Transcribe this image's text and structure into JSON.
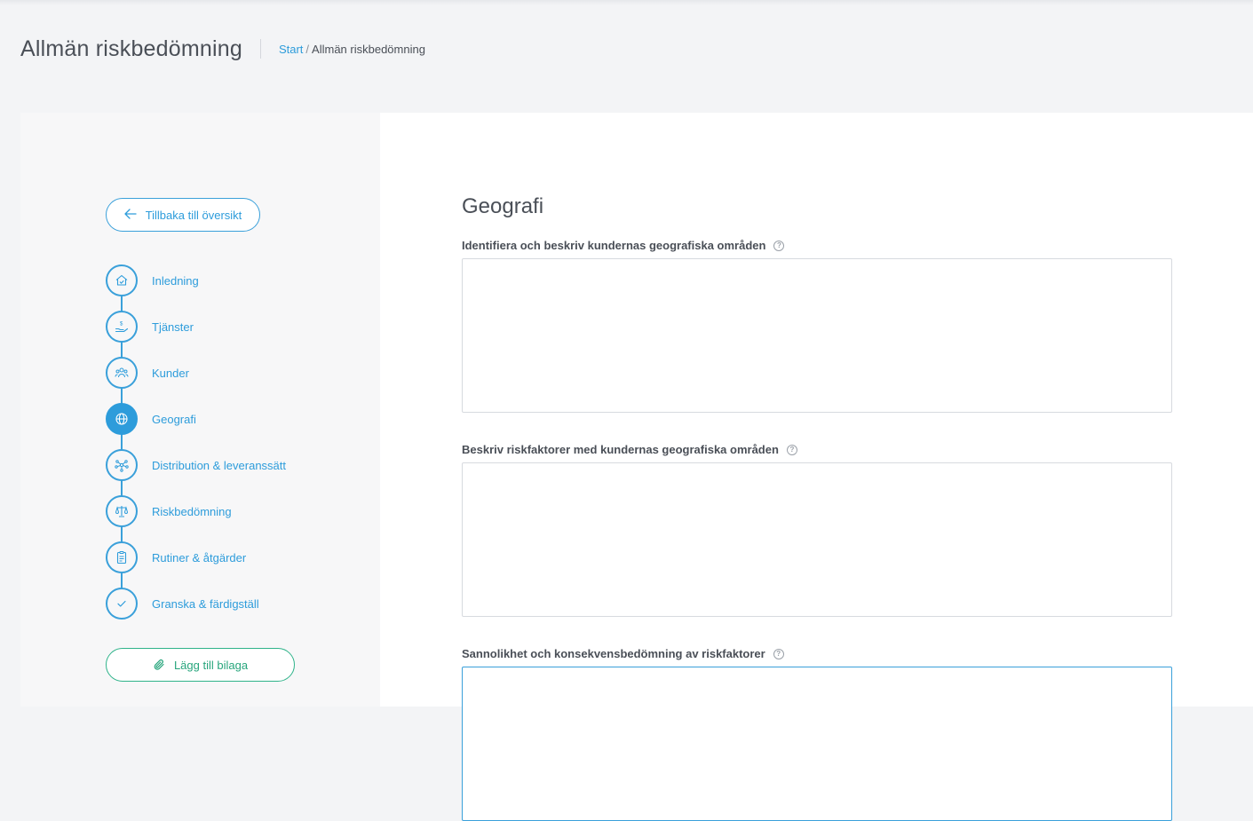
{
  "header": {
    "title": "Allmän riskbedömning",
    "breadcrumb": {
      "link": "Start",
      "separator": "/",
      "current": "Allmän riskbedömning"
    }
  },
  "sidebar": {
    "back_label": "Tillbaka till översikt",
    "attach_label": "Lägg till bilaga",
    "steps": [
      {
        "label": "Inledning",
        "icon": "house-check-icon"
      },
      {
        "label": "Tjänster",
        "icon": "hand-dollar-icon"
      },
      {
        "label": "Kunder",
        "icon": "people-icon"
      },
      {
        "label": "Geografi",
        "icon": "globe-icon",
        "active": true
      },
      {
        "label": "Distribution & leveranssätt",
        "icon": "network-icon"
      },
      {
        "label": "Riskbedömning",
        "icon": "scales-icon"
      },
      {
        "label": "Rutiner & åtgärder",
        "icon": "clipboard-icon"
      },
      {
        "label": "Granska & färdigställ",
        "icon": "checkmark-icon"
      }
    ]
  },
  "main": {
    "section_title": "Geografi",
    "fields": [
      {
        "label": "Identifiera och beskriv kundernas geografiska områden",
        "value": ""
      },
      {
        "label": "Beskriv riskfaktorer med kundernas geografiska områden",
        "value": ""
      },
      {
        "label": "Sannolikhet och konsekvensbedömning av riskfaktorer",
        "value": ""
      }
    ],
    "help_glyph": "?"
  },
  "colors": {
    "accent": "#2d9cdb",
    "attach_green": "#27a57c",
    "page_bg": "#f3f4f6",
    "sidebar_bg": "#f7f7f8"
  }
}
